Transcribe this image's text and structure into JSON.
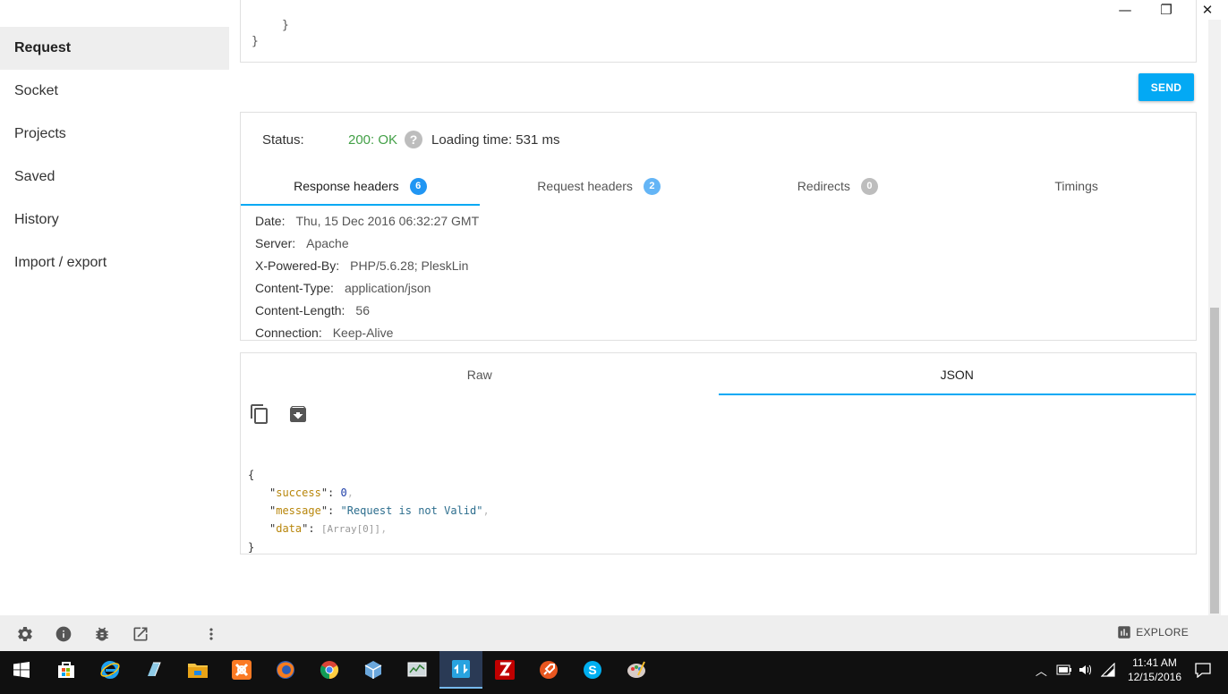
{
  "window": {
    "minimize": "—",
    "restore": "❐",
    "close": "✕"
  },
  "sidebar": {
    "items": [
      {
        "label": "Request",
        "active": true
      },
      {
        "label": "Socket"
      },
      {
        "label": "Projects"
      },
      {
        "label": "Saved"
      },
      {
        "label": "History"
      },
      {
        "label": "Import / export"
      }
    ]
  },
  "code_top": {
    "line1": "}",
    "line2": "}"
  },
  "send_label": "SEND",
  "response": {
    "status_label": "Status:",
    "status_value": "200: OK",
    "help": "?",
    "loading_time": "Loading time: 531 ms",
    "tabs": [
      {
        "label": "Response headers",
        "badge": "6",
        "active": true
      },
      {
        "label": "Request headers",
        "badge": "2"
      },
      {
        "label": "Redirects",
        "badge": "0"
      },
      {
        "label": "Timings"
      }
    ],
    "headers": [
      {
        "name": "Date:",
        "value": "Thu, 15 Dec 2016 06:32:27 GMT"
      },
      {
        "name": "Server:",
        "value": "Apache"
      },
      {
        "name": "X-Powered-By:",
        "value": "PHP/5.6.28; PleskLin"
      },
      {
        "name": "Content-Type:",
        "value": "application/json"
      },
      {
        "name": "Content-Length:",
        "value": "56"
      },
      {
        "name": "Connection:",
        "value": "Keep-Alive"
      }
    ]
  },
  "body": {
    "tabs": [
      {
        "label": "Raw"
      },
      {
        "label": "JSON",
        "active": true
      }
    ],
    "json": {
      "open": "{",
      "close": "}",
      "k1": "success",
      "v1": "0",
      "k2": "message",
      "v2": "\"Request is not Valid\"",
      "k3": "data",
      "v3": "[Array[0]]"
    }
  },
  "bottombar": {
    "explore_label": "EXPLORE"
  },
  "taskbar": {
    "time": "11:41 AM",
    "date": "12/15/2016"
  }
}
